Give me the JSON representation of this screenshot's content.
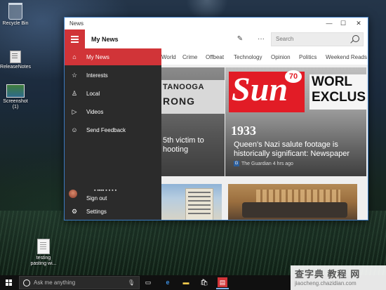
{
  "desktop": {
    "icons": [
      {
        "label": "Recycle Bin",
        "icon": "recycle-bin-icon"
      },
      {
        "label": "ReleaseNotes",
        "icon": "document-icon"
      },
      {
        "label": "Screenshot (1)",
        "icon": "image-file-icon"
      },
      {
        "label": "testing pasting wi...",
        "icon": "text-file-icon"
      }
    ]
  },
  "window": {
    "title": "News",
    "controls": {
      "minimize": "—",
      "maximize": "☐",
      "close": "✕"
    }
  },
  "app": {
    "header_title": "My News",
    "edit_icon": "pencil-icon",
    "more_label": "···",
    "search_placeholder": "Search",
    "categories": [
      "World",
      "Crime",
      "Offbeat",
      "Technology",
      "Opinion",
      "Politics",
      "Weekend Reads"
    ]
  },
  "nav": {
    "items": [
      {
        "label": "My News",
        "icon": "home-icon",
        "active": true
      },
      {
        "label": "Interests",
        "icon": "star-list-icon",
        "active": false
      },
      {
        "label": "Local",
        "icon": "person-location-icon",
        "active": false
      },
      {
        "label": "Videos",
        "icon": "play-icon",
        "active": false
      },
      {
        "label": "Send Feedback",
        "icon": "smiley-icon",
        "active": false
      }
    ],
    "account": {
      "name_obscured": "▪ ▪▪▪▪ ▪ ▪ ▪ ▪",
      "signout_label": "Sign out"
    },
    "settings_label": "Settings"
  },
  "articles": [
    {
      "caption": "5th victim to hooting",
      "marquee_line1": "TANOOGA",
      "marquee_line2": "RONG"
    },
    {
      "caption": "Queen's Nazi salute footage is historically significant: Newspaper",
      "source": "The Guardian",
      "age": "4 hrs ago",
      "masthead": "Sun",
      "issue": "70",
      "headline_line1": "WORL",
      "headline_line2": "EXCLUS",
      "year": "1933"
    }
  ],
  "taskbar": {
    "search_placeholder": "Ask me anything",
    "icons": [
      "task-view-icon",
      "edge-icon",
      "file-explorer-icon",
      "store-icon",
      "news-app-icon"
    ]
  },
  "watermark": {
    "line1": "查字典 教程 网",
    "line2": "jiaocheng.chazidian.com"
  },
  "colors": {
    "accent": "#d13438",
    "nav_bg": "#2b2b2b",
    "taskbar": "#101010"
  }
}
